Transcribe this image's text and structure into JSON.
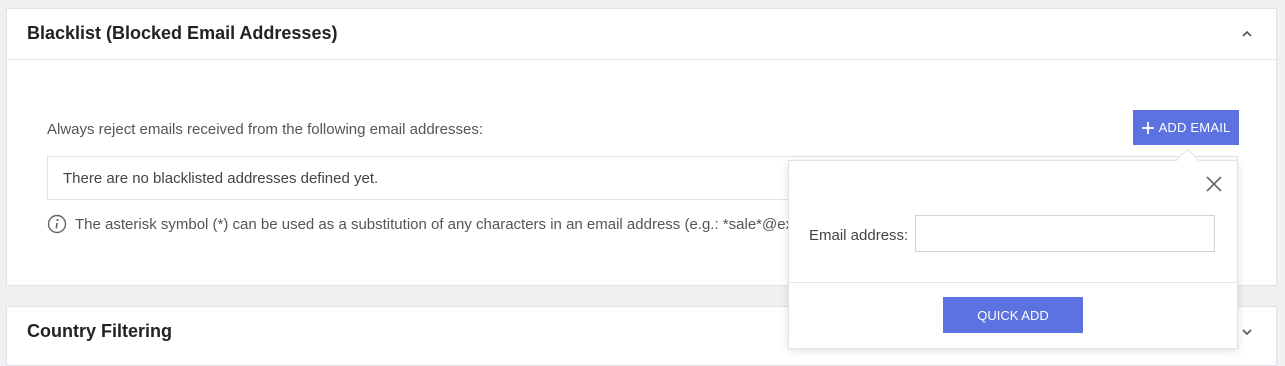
{
  "blacklist_panel": {
    "title": "Blacklist (Blocked Email Addresses)",
    "collapse_icon": "chevron-up-icon",
    "description": "Always reject emails received from the following email addresses:",
    "add_button_label": "ADD EMAIL",
    "add_button_icon": "plus-icon",
    "empty_message": "There are no blacklisted addresses defined yet.",
    "info_icon": "info-icon",
    "hint": "The asterisk symbol (*) can be used as a substitution of any characters in an email address (e.g.: *sale*@exa"
  },
  "country_panel": {
    "title": "Country Filtering",
    "expand_icon": "chevron-down-icon"
  },
  "quick_add_popup": {
    "close_icon": "close-icon",
    "email_label": "Email address:",
    "email_value": "",
    "email_placeholder": "",
    "submit_label": "QUICK ADD"
  },
  "colors": {
    "accent": "#5b72e0",
    "background": "#eef0f2",
    "panel": "#ffffff",
    "border": "#dfe2e6"
  }
}
